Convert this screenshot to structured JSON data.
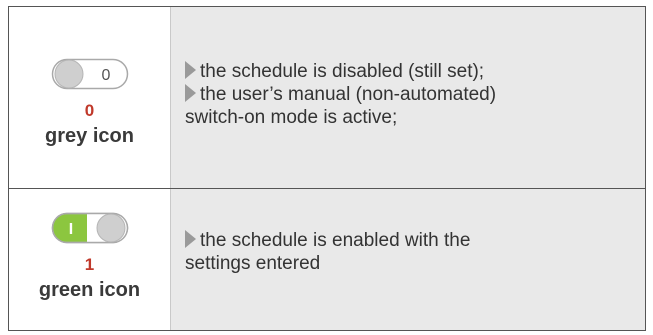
{
  "rows": [
    {
      "toggle_state": "off",
      "toggle_off_symbol": "0",
      "number": "0",
      "icon_label": "grey icon",
      "toggle_colors": {
        "body": "#d6d6d6",
        "knob": "#cfcfcf",
        "accent": "#8cc63f"
      },
      "description": [
        {
          "bullet": true,
          "text": "the schedule is disabled (still set);"
        },
        {
          "bullet": true,
          "text": "the user’s manual (non-automated)"
        },
        {
          "bullet": false,
          "text": "switch-on mode is active;"
        }
      ]
    },
    {
      "toggle_state": "on",
      "toggle_on_symbol": "I",
      "number": "1",
      "icon_label": "green icon",
      "description": [
        {
          "bullet": true,
          "text": "the schedule is enabled with the"
        },
        {
          "bullet": false,
          "text": "settings entered"
        }
      ]
    }
  ]
}
